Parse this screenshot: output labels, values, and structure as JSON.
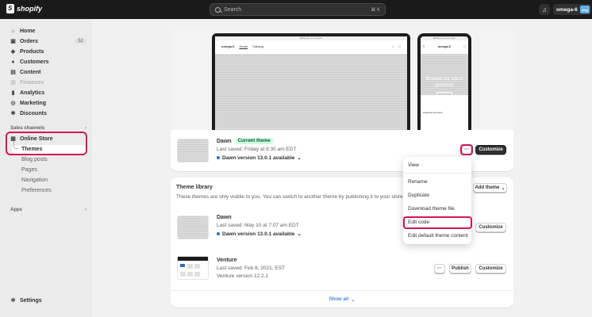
{
  "topbar": {
    "brand": "shopify",
    "search_placeholder": "Search",
    "search_shortcut": "⌘ K",
    "store_name": "omega-6",
    "store_avatar": "omg"
  },
  "sidebar": {
    "items": [
      {
        "label": "Home",
        "icon": "home-icon",
        "glyph": "⌂"
      },
      {
        "label": "Orders",
        "icon": "orders-icon",
        "glyph": "▣",
        "count": "52"
      },
      {
        "label": "Products",
        "icon": "tag-icon",
        "glyph": "◆"
      },
      {
        "label": "Customers",
        "icon": "person-icon",
        "glyph": "●"
      },
      {
        "label": "Content",
        "icon": "content-icon",
        "glyph": "▤"
      },
      {
        "label": "Finances",
        "icon": "bank-icon",
        "glyph": "▥"
      },
      {
        "label": "Analytics",
        "icon": "chart-icon",
        "glyph": "▮"
      },
      {
        "label": "Marketing",
        "icon": "target-icon",
        "glyph": "◎"
      },
      {
        "label": "Discounts",
        "icon": "discount-icon",
        "glyph": "✱"
      }
    ],
    "sales_channels_label": "Sales channels",
    "online_store_label": "Online Store",
    "online_store_sub": [
      "Themes",
      "Blog posts",
      "Pages",
      "Navigation",
      "Preferences"
    ],
    "apps_label": "Apps",
    "settings_label": "Settings"
  },
  "preview": {
    "laptop_bar_text": "Welcome to our store",
    "laptop_store_name": "omega-6",
    "laptop_nav": [
      "Home",
      "Catalog"
    ],
    "phone_bar_text": "Welcome to our store",
    "phone_store_name": "omega-6",
    "phone_hero_text": "Browse our latest products",
    "phone_featured": "Featured products"
  },
  "current_theme": {
    "name": "Dawn",
    "badge": "Current theme",
    "last_saved": "Last saved: Friday at 8:30 am EDT",
    "version_text": "Dawn version 13.0.1 available",
    "customize_label": "Customize",
    "more_label": "···"
  },
  "dropdown": {
    "items": [
      "View",
      "Rename",
      "Duplicate",
      "Download theme file",
      "Edit code",
      "Edit default theme content"
    ]
  },
  "library": {
    "title": "Theme library",
    "description": "These themes are only visible to you. You can switch to another theme by publishing it to your store.",
    "add_theme_label": "Add theme",
    "themes": [
      {
        "name": "Dawn",
        "last_saved": "Last saved: May 10 at 7:07 am EDT",
        "version_text": "Dawn version 13.0.1 available",
        "customize_label": "Customize"
      },
      {
        "name": "Venture",
        "last_saved": "Last saved: Feb 8, 2021, EST",
        "version_text": "Venture version 12.2.1",
        "more_label": "···",
        "publish_label": "Publish",
        "customize_label": "Customize"
      }
    ],
    "show_all_label": "Show all"
  },
  "colors": {
    "topbar": "#1a1a1a",
    "highlight": "#d4145a",
    "badge_bg": "#cdfee1",
    "link": "#005bd3"
  }
}
